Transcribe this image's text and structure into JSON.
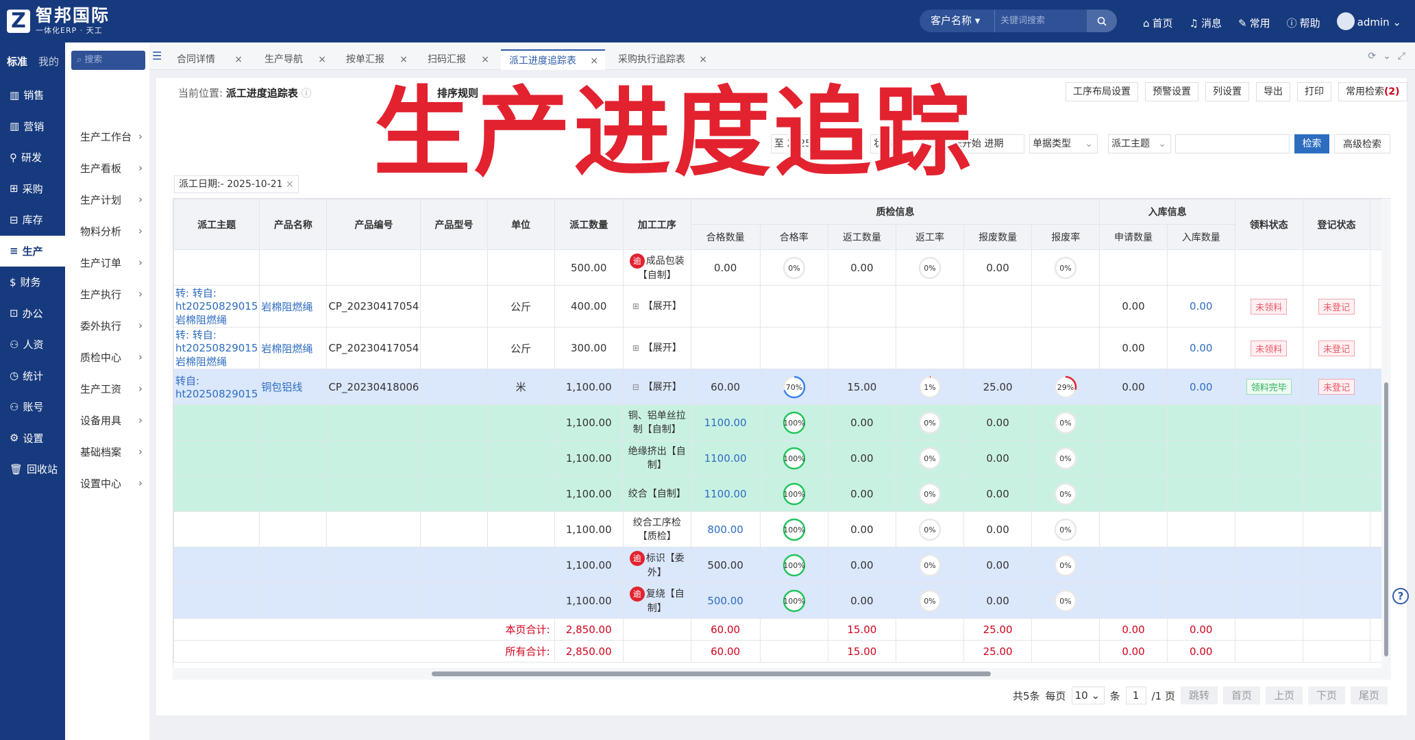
{
  "app": {
    "logo_mark": "Z",
    "name": "智邦国际",
    "subtitle": "一体化ERP · 天工"
  },
  "topbar": {
    "search_scope": "客户名称",
    "search_placeholder": "关键词搜索",
    "nav": [
      "首页",
      "消息",
      "常用",
      "帮助"
    ],
    "user": "admin"
  },
  "sidebar": {
    "tabs": [
      "标准",
      "我的"
    ],
    "items": [
      "销售",
      "营销",
      "研发",
      "采购",
      "库存",
      "生产",
      "财务",
      "办公",
      "人资",
      "统计",
      "账号",
      "设置",
      "回收站"
    ],
    "active": "生产"
  },
  "subnav": {
    "search_placeholder": "搜索",
    "items": [
      "生产工作台",
      "生产看板",
      "生产计划",
      "物料分析",
      "生产订单",
      "生产执行",
      "委外执行",
      "质检中心",
      "生产工资",
      "设备用具",
      "基础档案",
      "设置中心"
    ]
  },
  "tabs": [
    "合同详情",
    "生产导航",
    "按单汇报",
    "扫码汇报",
    "派工进度追踪表",
    "采购执行追踪表"
  ],
  "active_tab": "派工进度追踪表",
  "breadcrumb": {
    "prefix": "当前位置:",
    "current": "派工进度追踪表"
  },
  "sort_rule": "排序规则",
  "toolbar": {
    "buttons": [
      "工序布局设置",
      "预警设置",
      "列设置",
      "导出",
      "打印"
    ],
    "common_search": "常用检索",
    "common_search_count": "(2)"
  },
  "overlay_title": "生产进度追踪",
  "filters": {
    "date_label": "期:",
    "date_to": "至",
    "date_value": "2025-1",
    "status_partial": "状态",
    "unstarted_partial": "未开始 进期",
    "doc_type": "单据类型",
    "dispatch_subject": "派工主题",
    "search_btn": "检索",
    "advanced_btn": "高级检索"
  },
  "chip": "派工日期:- 2025-10-21",
  "table": {
    "headers": {
      "dispatch_subject": "派工主题",
      "product_name": "产品名称",
      "product_code": "产品编号",
      "product_model": "产品型号",
      "unit": "单位",
      "dispatch_qty": "派工数量",
      "process": "加工工序",
      "qc_group": "质检信息",
      "qc_cols": [
        "合格数量",
        "合格率",
        "返工数量",
        "返工率",
        "报废数量",
        "报废率"
      ],
      "stock_group": "入库信息",
      "stock_cols": [
        "申请数量",
        "入库数量"
      ],
      "pick_status": "领料状态",
      "register_status": "登记状态"
    },
    "rows": [
      {
        "subject": "",
        "name": "",
        "code": "",
        "model": "",
        "unit": "",
        "qty": "500.00",
        "overdue": true,
        "process": "成品包装【自制】",
        "pass_qty": "0.00",
        "pass_rate": "0%",
        "pass_pct": 0,
        "rework_qty": "0.00",
        "rework_rate": "0%",
        "rework_pct": 0,
        "scrap_qty": "0.00",
        "scrap_rate": "0%",
        "scrap_pct": 0,
        "apply_qty": "",
        "stock_qty": "",
        "pick": "",
        "reg": "",
        "bg": "white",
        "type": "detail"
      },
      {
        "subject": "转: 转自: ht20250829015岩棉阻燃绳",
        "name": "岩棉阻燃绳",
        "code": "CP_20230417054",
        "model": "",
        "unit": "公斤",
        "qty": "400.00",
        "process": "【展开】",
        "expand": "+",
        "apply_qty": "0.00",
        "stock_qty": "0.00",
        "pick": "未领料",
        "reg": "未登记",
        "bg": "white",
        "type": "summary"
      },
      {
        "subject": "转: 转自: ht20250829015岩棉阻燃绳",
        "name": "岩棉阻燃绳",
        "code": "CP_20230417054",
        "model": "",
        "unit": "公斤",
        "qty": "300.00",
        "process": "【展开】",
        "expand": "+",
        "apply_qty": "0.00",
        "stock_qty": "0.00",
        "pick": "未领料",
        "reg": "未登记",
        "bg": "white",
        "type": "summary"
      },
      {
        "subject": "转自: ht20250829015",
        "name": "铜包铝线",
        "code": "CP_20230418006",
        "model": "",
        "unit": "米",
        "qty": "1,100.00",
        "process": "【展开】",
        "expand": "−",
        "pass_qty": "60.00",
        "pass_rate": "70%",
        "pass_pct": 70,
        "rework_qty": "15.00",
        "rework_rate": "1%",
        "rework_pct": 1,
        "scrap_qty": "25.00",
        "scrap_rate": "29%",
        "scrap_pct": 29,
        "apply_qty": "0.00",
        "stock_qty": "0.00",
        "pick": "领料完毕",
        "reg": "未登记",
        "bg": "blue",
        "type": "summary_full"
      },
      {
        "qty": "1,100.00",
        "process": "铜、铝单丝拉制【自制】",
        "pass_qty": "1100.00",
        "pass_link": true,
        "pass_rate": "100%",
        "pass_pct": 100,
        "rework_qty": "0.00",
        "rework_rate": "0%",
        "rework_pct": 0,
        "scrap_qty": "0.00",
        "scrap_rate": "0%",
        "scrap_pct": 0,
        "bg": "green",
        "type": "detail"
      },
      {
        "qty": "1,100.00",
        "process": "绝缘挤出【自制】",
        "pass_qty": "1100.00",
        "pass_link": true,
        "pass_rate": "100%",
        "pass_pct": 100,
        "rework_qty": "0.00",
        "rework_rate": "0%",
        "rework_pct": 0,
        "scrap_qty": "0.00",
        "scrap_rate": "0%",
        "scrap_pct": 0,
        "bg": "green",
        "type": "detail"
      },
      {
        "qty": "1,100.00",
        "process": "绞合【自制】",
        "pass_qty": "1100.00",
        "pass_link": true,
        "pass_rate": "100%",
        "pass_pct": 100,
        "rework_qty": "0.00",
        "rework_rate": "0%",
        "rework_pct": 0,
        "scrap_qty": "0.00",
        "scrap_rate": "0%",
        "scrap_pct": 0,
        "bg": "green",
        "type": "detail"
      },
      {
        "qty": "1,100.00",
        "process": "绞合工序检【质检】",
        "pass_qty": "800.00",
        "pass_link": true,
        "pass_rate": "100%",
        "pass_pct": 100,
        "rework_qty": "0.00",
        "rework_rate": "0%",
        "rework_pct": 0,
        "scrap_qty": "0.00",
        "scrap_rate": "0%",
        "scrap_pct": 0,
        "bg": "white",
        "type": "detail"
      },
      {
        "qty": "1,100.00",
        "overdue": true,
        "process": "标识【委外】",
        "pass_qty": "500.00",
        "pass_rate": "100%",
        "pass_pct": 100,
        "rework_qty": "0.00",
        "rework_rate": "0%",
        "rework_pct": 0,
        "scrap_qty": "0.00",
        "scrap_rate": "0%",
        "scrap_pct": 0,
        "bg": "blue",
        "type": "detail"
      },
      {
        "qty": "1,100.00",
        "overdue": true,
        "process": "复绕【自制】",
        "pass_qty": "500.00",
        "pass_link": true,
        "pass_rate": "100%",
        "pass_pct": 100,
        "rework_qty": "0.00",
        "rework_rate": "0%",
        "rework_pct": 0,
        "scrap_qty": "0.00",
        "scrap_rate": "0%",
        "scrap_pct": 0,
        "bg": "blue",
        "type": "detail"
      }
    ],
    "overdue_mark": "逾",
    "totals": [
      {
        "label": "本页合计:",
        "qty": "2,850.00",
        "pass_qty": "60.00",
        "rework_qty": "15.00",
        "scrap_qty": "25.00",
        "apply_qty": "0.00",
        "stock_qty": "0.00"
      },
      {
        "label": "所有合计:",
        "qty": "2,850.00",
        "pass_qty": "60.00",
        "rework_qty": "15.00",
        "scrap_qty": "25.00",
        "apply_qty": "0.00",
        "stock_qty": "0.00"
      }
    ]
  },
  "pager": {
    "total": "共5条",
    "per_page_label": "每页",
    "per_page": "10",
    "unit": "条",
    "page": "1",
    "pages": "/1 页",
    "buttons": [
      "跳转",
      "首页",
      "上页",
      "下页",
      "尾页"
    ]
  },
  "colors": {
    "primary": "#173a7e",
    "accent": "#2d5aa7",
    "danger": "#e3222f",
    "row_green": "#c9f1e2",
    "row_blue": "#dbe7fb"
  }
}
